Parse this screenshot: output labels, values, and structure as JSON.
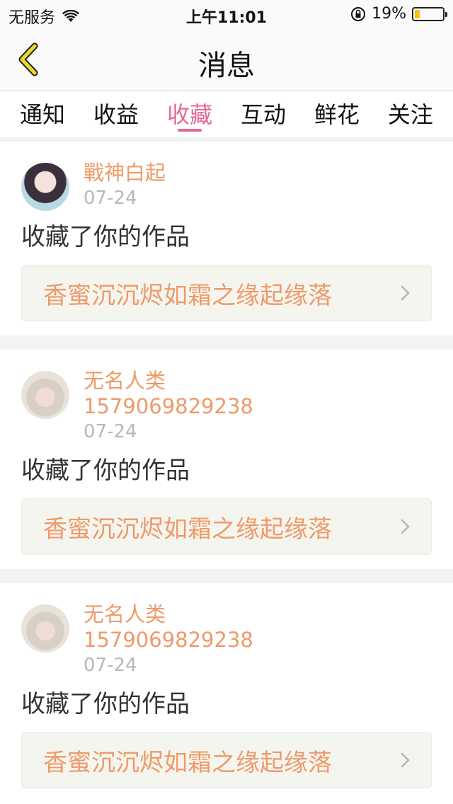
{
  "status_bar": {
    "carrier": "无服务",
    "time": "上午11:01",
    "battery_percent": "19%",
    "battery_level": 0.19
  },
  "nav": {
    "title": "消息"
  },
  "tabs": [
    {
      "label": "通知",
      "active": false
    },
    {
      "label": "收益",
      "active": false
    },
    {
      "label": "收藏",
      "active": true
    },
    {
      "label": "互动",
      "active": false
    },
    {
      "label": "鲜花",
      "active": false
    },
    {
      "label": "关注",
      "active": false
    }
  ],
  "messages": [
    {
      "user_name": "戰神白起",
      "user_id": "",
      "date": "07-24",
      "text": "收藏了你的作品",
      "work_title": "香蜜沉沉烬如霜之缘起缘落"
    },
    {
      "user_name": "无名人类",
      "user_id": "1579069829238",
      "date": "07-24",
      "text": "收藏了你的作品",
      "work_title": "香蜜沉沉烬如霜之缘起缘落"
    },
    {
      "user_name": "无名人类",
      "user_id": "1579069829238",
      "date": "07-24",
      "text": "收藏了你的作品",
      "work_title": "香蜜沉沉烬如霜之缘起缘落"
    }
  ],
  "colors": {
    "accent": "#e8679b",
    "username": "#ef9a6a",
    "back_arrow": "#f0d82a"
  },
  "icons": {
    "back": "chevron-left-icon",
    "link": "chevron-right-icon",
    "wifi": "wifi-icon",
    "rotation_lock": "rotation-lock-icon",
    "battery": "battery-icon"
  }
}
